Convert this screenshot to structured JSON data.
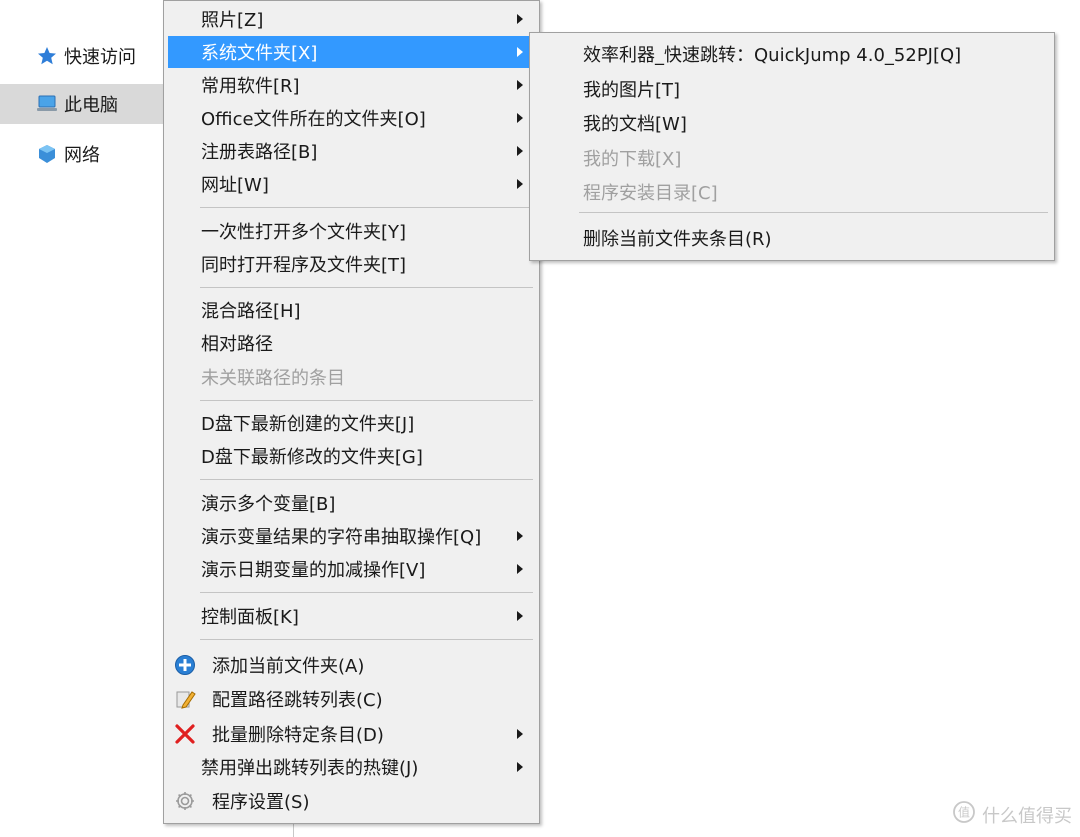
{
  "nav": {
    "items": [
      {
        "label": "快速访问",
        "icon": "star-pin-icon",
        "selected": false
      },
      {
        "label": "此电脑",
        "icon": "computer-icon",
        "selected": true
      },
      {
        "label": "网络",
        "icon": "network-icon",
        "selected": false
      }
    ]
  },
  "menu": {
    "items": {
      "photos": "照片[Z]",
      "system_folders": "系统文件夹[X]",
      "common_software": "常用软件[R]",
      "office_folder": "Office文件所在的文件夹[O]",
      "registry_path": "注册表路径[B]",
      "url": "网址[W]",
      "open_multiple": "一次性打开多个文件夹[Y]",
      "open_program_and_folder": "同时打开程序及文件夹[T]",
      "mixed_path": "混合路径[H]",
      "relative_path": "相对路径",
      "unlinked_items": "未关联路径的条目",
      "d_newest_created": "D盘下最新创建的文件夹[J]",
      "d_newest_modified": "D盘下最新修改的文件夹[G]",
      "demo_vars": "演示多个变量[B]",
      "demo_string_extract": "演示变量结果的字符串抽取操作[Q]",
      "demo_date_math": "演示日期变量的加减操作[V]",
      "control_panel": "控制面板[K]",
      "add_current": "添加当前文件夹(A)",
      "config_list": "配置路径跳转列表(C)",
      "batch_delete": "批量删除特定条目(D)",
      "disable_hotkey": "禁用弹出跳转列表的热键(J)",
      "settings": "程序设置(S)"
    }
  },
  "submenu": {
    "items": {
      "quickjump": "效率利器_快速跳转：QuickJump 4.0_52PJ[Q]",
      "my_pictures": "我的图片[T]",
      "my_documents": "我的文档[W]",
      "my_downloads": "我的下载[X]",
      "program_dir": "程序安装目录[C]",
      "delete_entry": "删除当前文件夹条目(R)"
    }
  },
  "watermark": {
    "text": "什么值得买",
    "icon": "smzdm-logo-icon"
  },
  "colors": {
    "highlight": "#3399ff",
    "menu_bg": "#f0f0f0",
    "disabled": "#a0a0a0",
    "nav_selected": "#d9d9d9"
  }
}
